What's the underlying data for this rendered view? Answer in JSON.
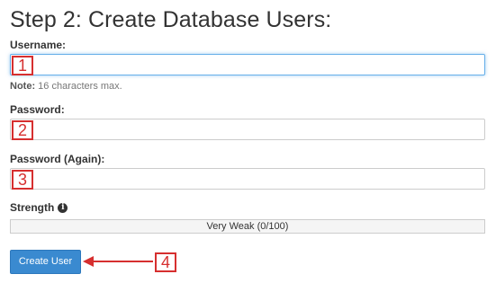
{
  "page": {
    "title": "Step 2: Create Database Users:"
  },
  "form": {
    "username_label": "Username:",
    "username_value": "",
    "note_label": "Note:",
    "note_text": "16 characters max.",
    "password_label": "Password:",
    "password_value": "",
    "password_again_label": "Password (Again):",
    "password_again_value": "",
    "strength_label": "Strength",
    "strength_info_icon": "info-circle-icon",
    "strength_text": "Very Weak (0/100)",
    "strength_value": 0,
    "create_button_label": "Create User"
  },
  "annotations": {
    "marker_1": "1",
    "marker_2": "2",
    "marker_3": "3",
    "marker_4": "4",
    "color": "#d62f2f"
  },
  "colors": {
    "button_bg": "#3a8ad0",
    "focus_border": "#66afe9",
    "strength_fill": "#d9534f"
  }
}
